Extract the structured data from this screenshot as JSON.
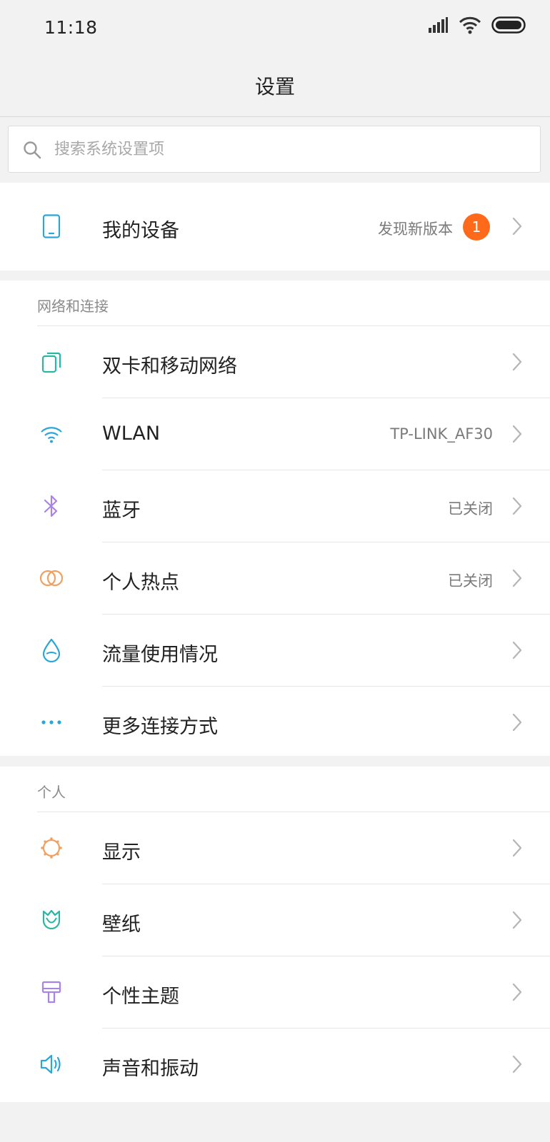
{
  "status": {
    "time": "11:18",
    "signal_icon": "signal-icon",
    "wifi_icon": "wifi-icon",
    "battery_icon": "battery-icon"
  },
  "header": {
    "title": "设置"
  },
  "search": {
    "placeholder": "搜索系统设置项",
    "value": ""
  },
  "device": {
    "label": "我的设备",
    "value": "发现新版本",
    "badge": "1"
  },
  "sections": {
    "network": {
      "title": "网络和连接",
      "items": [
        {
          "label": "双卡和移动网络",
          "value": "",
          "icon": "sim-card-icon",
          "color": "#2bb5a3"
        },
        {
          "label": "WLAN",
          "value": "TP-LINK_AF30",
          "icon": "wifi-icon",
          "color": "#2aa6d8"
        },
        {
          "label": "蓝牙",
          "value": "已关闭",
          "icon": "bluetooth-icon",
          "color": "#a883e8"
        },
        {
          "label": "个人热点",
          "value": "已关闭",
          "icon": "hotspot-icon",
          "color": "#f0a060"
        },
        {
          "label": "流量使用情况",
          "value": "",
          "icon": "data-usage-icon",
          "color": "#2aa6d8"
        },
        {
          "label": "更多连接方式",
          "value": "",
          "icon": "more-icon",
          "color": "#2aa6d8"
        }
      ]
    },
    "personal": {
      "title": "个人",
      "items": [
        {
          "label": "显示",
          "value": "",
          "icon": "display-icon",
          "color": "#f0a060"
        },
        {
          "label": "壁纸",
          "value": "",
          "icon": "wallpaper-icon",
          "color": "#2bb5a3"
        },
        {
          "label": "个性主题",
          "value": "",
          "icon": "theme-icon",
          "color": "#a883e8"
        },
        {
          "label": "声音和振动",
          "value": "",
          "icon": "sound-icon",
          "color": "#2aa6d8"
        }
      ]
    }
  },
  "colors": {
    "background": "#f2f2f2",
    "card": "#ffffff",
    "badge": "#ff6a1a",
    "text": "#222222",
    "secondary_text": "#7a7a7a"
  }
}
